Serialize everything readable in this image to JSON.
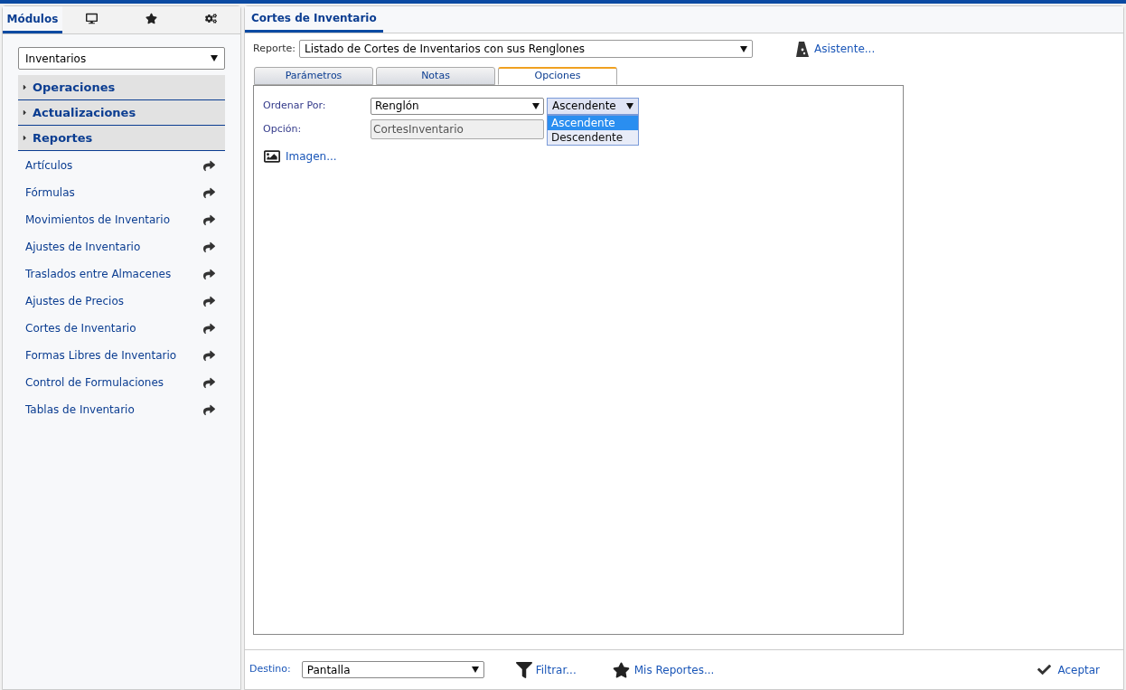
{
  "sidebar": {
    "tabs": [
      {
        "kind": "text",
        "label": "Módulos",
        "selected": true
      },
      {
        "kind": "monitor",
        "selected": false
      },
      {
        "kind": "star",
        "selected": false
      },
      {
        "kind": "gears",
        "selected": false
      }
    ],
    "module_select": {
      "value": "Inventarios"
    },
    "sections": [
      {
        "label": "Operaciones",
        "expanded": false
      },
      {
        "label": "Actualizaciones",
        "expanded": false
      },
      {
        "label": "Reportes",
        "expanded": false
      }
    ],
    "links": [
      "Artículos",
      "Fórmulas",
      "Movimientos de Inventario",
      "Ajustes de Inventario",
      "Traslados entre Almacenes",
      "Ajustes de Precios",
      "Cortes de Inventario",
      "Formas Libres de Inventario",
      "Control de Formulaciones",
      "Tablas de Inventario"
    ]
  },
  "main": {
    "tab": {
      "label": "Cortes de Inventario",
      "selected": true
    },
    "report": {
      "label": "Reporte:",
      "value": "Listado de Cortes de Inventarios con sus Renglones"
    },
    "wizard": {
      "label": "Asistente..."
    },
    "tabs": [
      {
        "label": "Parámetros",
        "selected": false
      },
      {
        "label": "Notas",
        "selected": false
      },
      {
        "label": "Opciones",
        "selected": true
      }
    ],
    "order_by": {
      "label": "Ordenar Por:",
      "value": "Renglón"
    },
    "direction": {
      "value": "Ascendente",
      "expanded": true,
      "options": [
        {
          "label": "Ascendente",
          "selected": true
        },
        {
          "label": "Descendente",
          "selected": false
        }
      ]
    },
    "option": {
      "label": "Opción:",
      "value": "CortesInventario",
      "disabled": true
    },
    "image_link": {
      "label": "Imagen..."
    },
    "footer": {
      "destination_label": "Destino:",
      "destination_value": "Pantalla",
      "filter": "Filtrar...",
      "my_reports": "Mis Reportes...",
      "accept": "Aceptar"
    }
  }
}
